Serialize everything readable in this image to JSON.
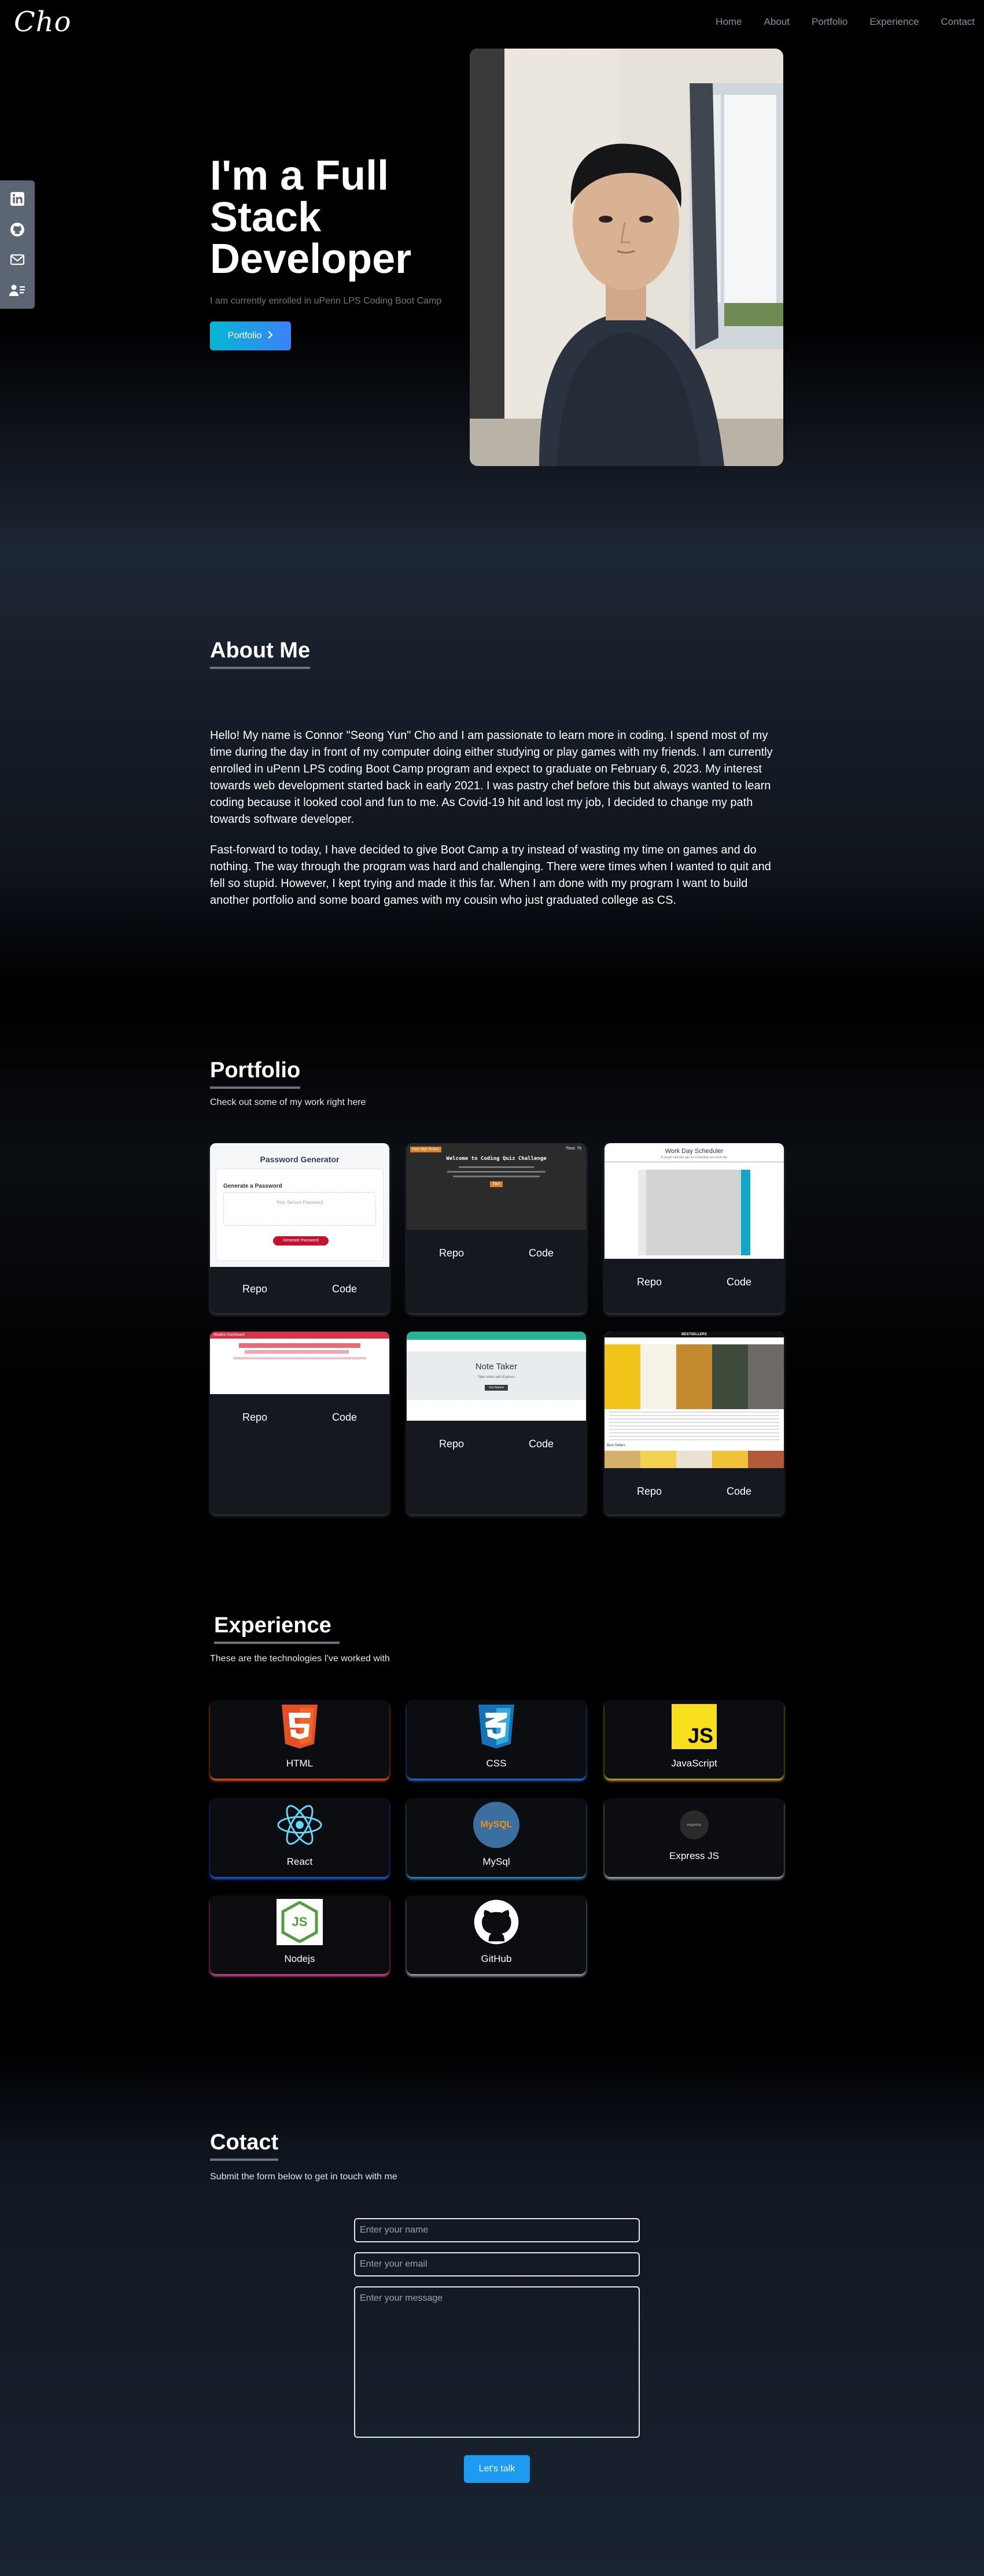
{
  "nav": {
    "logo": "Cho",
    "links": [
      "Home",
      "About",
      "Portfolio",
      "Experience",
      "Contact"
    ]
  },
  "social": {
    "icons": [
      "linkedin-icon",
      "github-icon",
      "mail-icon",
      "resume-icon"
    ],
    "bg_color": "#5b6574"
  },
  "hero": {
    "title": "I'm a Full Stack Developer",
    "subtitle": "I am currently enrolled in uPenn LPS Coding Boot Camp",
    "button_label": "Portfolio",
    "button_colors": [
      "#06b6d4",
      "#3b82f6"
    ]
  },
  "about": {
    "title": "About Me",
    "paragraphs": [
      "Hello! My name is Connor \"Seong Yun\" Cho and I am passionate to learn more in coding. I spend most of my time during the day in front of my computer doing either studying or play games with my friends. I am currently enrolled in uPenn LPS coding Boot Camp program and expect to graduate on February 6, 2023. My interest towards web development started back in early 2021. I was pastry chef before this but always wanted to learn coding because it looked cool and fun to me. As Covid-19 hit and lost my job, I decided to change my path towards software developer.",
      "Fast-forward to today, I have decided to give Boot Camp a try instead of wasting my time on games and do nothing. The way through the program was hard and challenging. There were times when I wanted to quit and fell so stupid. However, I kept trying and made it this far. When I am done with my program I want to build another portfolio and some board games with my cousin who just graduated college as CS."
    ]
  },
  "portfolio": {
    "title": "Portfolio",
    "subtitle": "Check out some of my work right here",
    "cards": [
      {
        "repo": "Repo",
        "code": "Code",
        "thumb_title": "Password Generator",
        "thumb_label": "Generate a Password",
        "thumb_placeholder": "Your Secure Password",
        "thumb_button": "Generate Password"
      },
      {
        "repo": "Repo",
        "code": "Code",
        "thumb_title": "Welcome to Coding Quiz Challenge",
        "thumb_badge": "View High Scores",
        "thumb_timer": "Time: 75",
        "thumb_button": "Start"
      },
      {
        "repo": "Repo",
        "code": "Code",
        "thumb_title": "Work Day Scheduler",
        "thumb_sub": "A simple calendar app for scheduling your work day"
      },
      {
        "repo": "Repo",
        "code": "Code",
        "thumb_title": "Weather Dashboard"
      },
      {
        "repo": "Repo",
        "code": "Code",
        "thumb_title": "Note Taker",
        "thumb_sub": "Take notes with Express",
        "thumb_button": "Get Started"
      },
      {
        "repo": "Repo",
        "code": "Code",
        "thumb_title": "BESTSELLERS",
        "thumb_section": "Best Sellers"
      }
    ]
  },
  "experience": {
    "title": "Experience",
    "subtitle": "These are the technologies I've worked with",
    "items": [
      {
        "label": "HTML",
        "icon": "html5-icon",
        "glow": "#e2541f",
        "badge": "5"
      },
      {
        "label": "CSS",
        "icon": "css3-icon",
        "glow": "#2a6bd6",
        "badge": "3"
      },
      {
        "label": "JavaScript",
        "icon": "javascript-icon",
        "glow": "#c9a227",
        "badge": "JS"
      },
      {
        "label": "React",
        "icon": "react-icon",
        "glow": "#2657d6"
      },
      {
        "label": "MySql",
        "icon": "mysql-icon",
        "glow": "#2f87c7",
        "badge": "MySQL"
      },
      {
        "label": "Express JS",
        "icon": "express-icon",
        "glow": "#9ca3af",
        "badge": "express"
      },
      {
        "label": "Nodejs",
        "icon": "nodejs-icon",
        "glow": "#d14a8e",
        "badge": "JS"
      },
      {
        "label": "GitHub",
        "icon": "github-icon",
        "glow": "#9ca3af"
      }
    ]
  },
  "contact": {
    "title": "Cotact",
    "subtitle": "Submit the form below to get in touch with me",
    "name_placeholder": "Enter your name",
    "email_placeholder": "Enter your email",
    "message_placeholder": "Enter your message",
    "submit_label": "Let's talk",
    "submit_color": "#1d9bf0"
  }
}
